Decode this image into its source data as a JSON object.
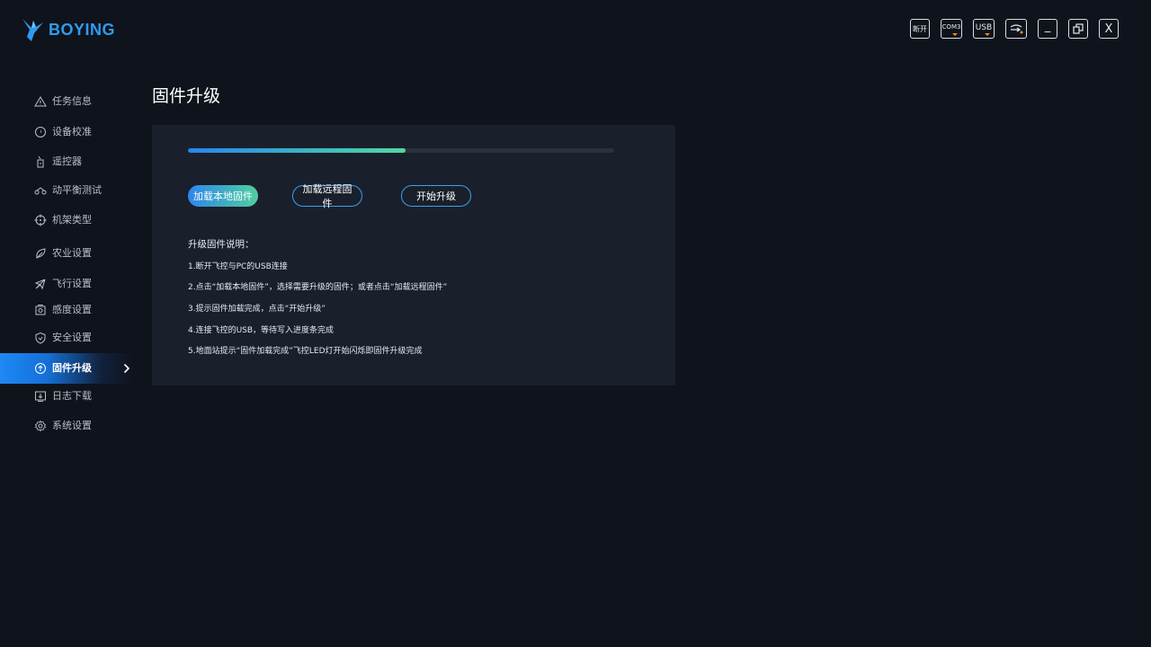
{
  "app": {
    "brand": "BOYING"
  },
  "top_controls": [
    {
      "name": "disconnect-button",
      "label": "断开"
    },
    {
      "name": "com-port-select",
      "label": "COM3"
    },
    {
      "name": "usb-select",
      "label": "USB"
    },
    {
      "name": "link-icon-button",
      "label": ""
    },
    {
      "name": "minimize-button",
      "label": "_"
    },
    {
      "name": "restore-button",
      "label": ""
    },
    {
      "name": "close-button",
      "label": "X"
    }
  ],
  "sidebar": {
    "items": [
      {
        "id": "mission",
        "label": "任务信息",
        "icon": "warning-triangle-icon"
      },
      {
        "id": "calibration",
        "label": "设备校准",
        "icon": "compass-icon"
      },
      {
        "id": "remote",
        "label": "遥控器",
        "icon": "remote-controller-icon"
      },
      {
        "id": "balance",
        "label": "动平衡测试",
        "icon": "motor-balance-icon"
      },
      {
        "id": "frame",
        "label": "机架类型",
        "icon": "crosshair-icon"
      },
      {
        "id": "agri",
        "label": "农业设置",
        "icon": "leaf-icon"
      },
      {
        "id": "flight",
        "label": "飞行设置",
        "icon": "plane-icon"
      },
      {
        "id": "sensitivity",
        "label": "感度设置",
        "icon": "sensor-icon"
      },
      {
        "id": "safety",
        "label": "安全设置",
        "icon": "shield-icon"
      },
      {
        "id": "firmware",
        "label": "固件升级",
        "icon": "upload-circle-icon",
        "active": true
      },
      {
        "id": "logs",
        "label": "日志下载",
        "icon": "download-box-icon"
      },
      {
        "id": "system",
        "label": "系统设置",
        "icon": "gear-icon"
      }
    ]
  },
  "main": {
    "title": "固件升级",
    "progress": 0.51,
    "buttons": {
      "load_local": "加载本地固件",
      "load_remote": "加载远程固件",
      "start": "开始升级"
    },
    "instructions_title": "升级固件说明：",
    "instructions": [
      "1.断开飞控与PC的USB连接",
      "2.点击“加载本地固件”，选择需要升级的固件；或者点击“加载远程固件”",
      "3.提示固件加载完成，点击“开始升级”",
      "4.连接飞控的USB，等待写入进度条完成",
      "5.地面站提示“固件加载完成”飞控LED灯开始闪烁即固件升级完成"
    ]
  },
  "colors": {
    "background": "#0f131b",
    "panel": "#19202b",
    "accent_blue": "#2f86ee",
    "accent_green": "#4fcf9f"
  }
}
